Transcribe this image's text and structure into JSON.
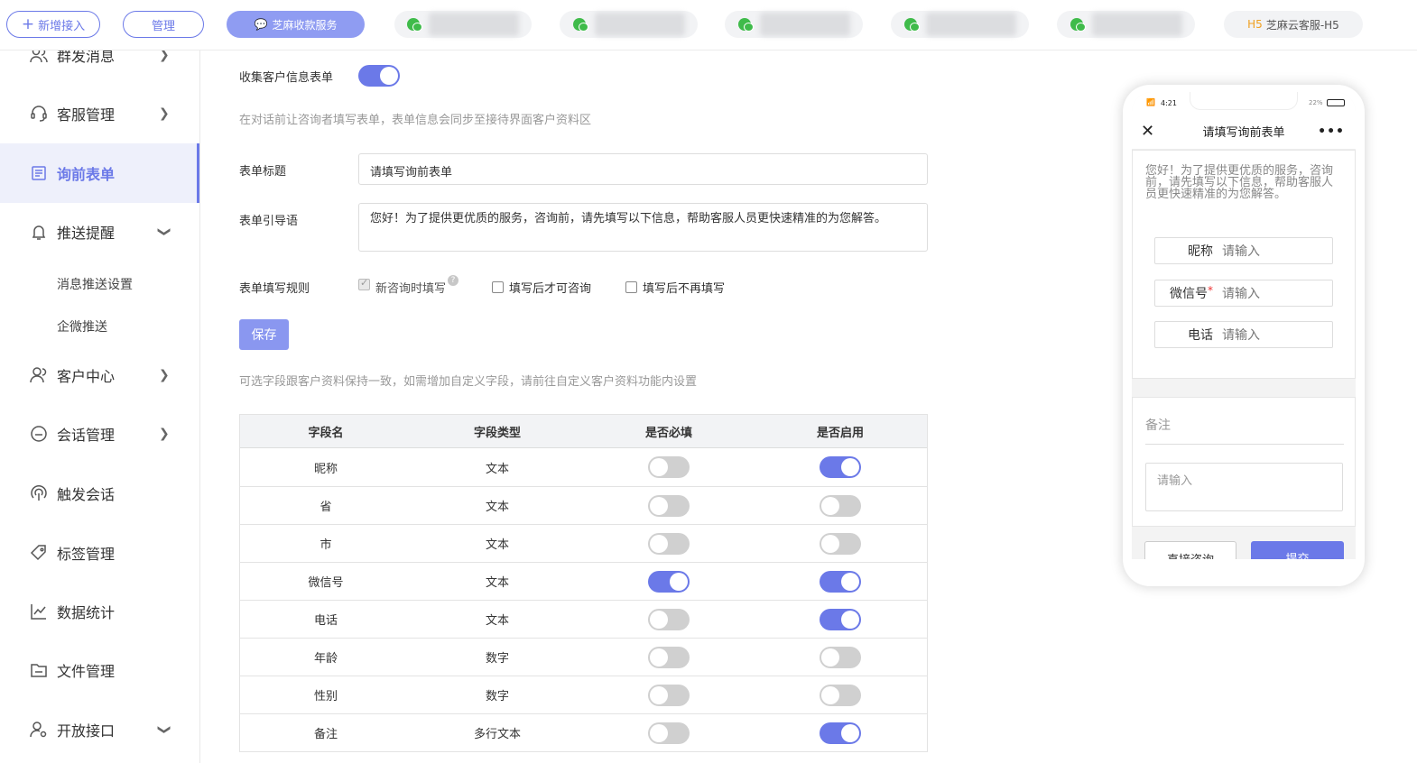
{
  "topbar": {
    "new_access": "新增接入",
    "manage": "管理",
    "active_tab": "芝麻收款服务",
    "h5_prefix": "H5",
    "h5_tab": "芝麻云客服-H5"
  },
  "sidebar": {
    "items": [
      {
        "label": "群发消息",
        "icon": "users-icon"
      },
      {
        "label": "客服管理",
        "icon": "headset-icon"
      },
      {
        "label": "询前表单",
        "icon": "form-icon"
      },
      {
        "label": "推送提醒",
        "icon": "bell-icon"
      },
      {
        "label": "客户中心",
        "icon": "user-icon"
      },
      {
        "label": "会话管理",
        "icon": "chat-icon"
      },
      {
        "label": "触发会话",
        "icon": "signal-icon"
      },
      {
        "label": "标签管理",
        "icon": "tag-icon"
      },
      {
        "label": "数据统计",
        "icon": "chart-icon"
      },
      {
        "label": "文件管理",
        "icon": "folder-icon"
      },
      {
        "label": "开放接口",
        "icon": "api-icon"
      }
    ],
    "sub_items": [
      "消息推送设置",
      "企微推送"
    ]
  },
  "form": {
    "collect_label": "收集客户信息表单",
    "collect_enabled": true,
    "collect_hint": "在对话前让咨询者填写表单，表单信息会同步至接待界面客户资料区",
    "title_label": "表单标题",
    "title_value": "请填写询前表单",
    "guide_label": "表单引导语",
    "guide_value": "您好！为了提供更优质的服务，咨询前，请先填写以下信息，帮助客服人员更快速精准的为您解答。",
    "rule_label": "表单填写规则",
    "rules": [
      {
        "label": "新咨询时填写",
        "checked": true,
        "disabled": true
      },
      {
        "label": "填写后才可咨询",
        "checked": false
      },
      {
        "label": "填写后不再填写",
        "checked": false
      }
    ],
    "save": "保存",
    "fields_hint": "可选字段跟客户资料保持一致，如需增加自定义字段，请前往自定义客户资料功能内设置"
  },
  "table": {
    "headers": [
      "字段名",
      "字段类型",
      "是否必填",
      "是否启用"
    ],
    "rows": [
      {
        "name": "昵称",
        "type": "文本",
        "required": false,
        "enabled": true
      },
      {
        "name": "省",
        "type": "文本",
        "required": false,
        "enabled": false
      },
      {
        "name": "市",
        "type": "文本",
        "required": false,
        "enabled": false
      },
      {
        "name": "微信号",
        "type": "文本",
        "required": true,
        "enabled": true
      },
      {
        "name": "电话",
        "type": "文本",
        "required": false,
        "enabled": true
      },
      {
        "name": "年龄",
        "type": "数字",
        "required": false,
        "enabled": false
      },
      {
        "name": "性别",
        "type": "数字",
        "required": false,
        "enabled": false
      },
      {
        "name": "备注",
        "type": "多行文本",
        "required": false,
        "enabled": true
      }
    ]
  },
  "preview": {
    "time": "4:21",
    "battery": "22%",
    "title": "请填写询前表单",
    "intro": "您好！为了提供更优质的服务，咨询前，请先填写以下信息，帮助客服人员更快速精准的为您解答。",
    "fields": [
      {
        "label": "昵称",
        "placeholder": "请输入",
        "required": false
      },
      {
        "label": "微信号",
        "placeholder": "请输入",
        "required": true
      },
      {
        "label": "电话",
        "placeholder": "请输入",
        "required": false
      }
    ],
    "required_mark": "*",
    "remark_label": "备注",
    "remark_placeholder": "请输入",
    "direct_btn": "直接咨询",
    "submit_btn": "提交"
  },
  "colors": {
    "accent": "#6b79e8",
    "toggle_off": "#d0d0d0"
  }
}
